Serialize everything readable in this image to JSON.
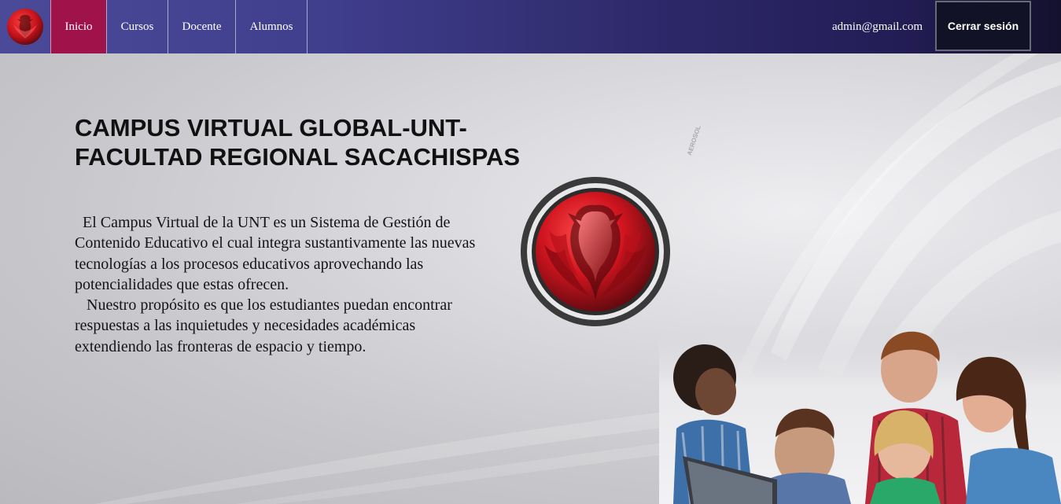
{
  "navbar": {
    "logo_icon": "phoenix-logo-icon",
    "items": [
      {
        "label": "Inicio",
        "active": true
      },
      {
        "label": "Cursos",
        "active": false
      },
      {
        "label": "Docente",
        "active": false
      },
      {
        "label": "Alumnos",
        "active": false
      }
    ],
    "user_email": "admin@gmail.com",
    "logout_label": "Cerrar sesión",
    "colors": {
      "active": "#a0124a",
      "bar_start": "#4a4a98",
      "bar_end": "#14112e"
    }
  },
  "hero": {
    "title": " CAMPUS VIRTUAL GLOBAL-UNT-\nFACULTAD REGIONAL SACACHISPAS",
    "paragraph_1": "  El Campus Virtual de la UNT es un Sistema de Gestión de Contenido Educativo el cual integra sustantivamente las nuevas tecnologías a los procesos educativos aprovechando las potencialidades que estas ofrecen.",
    "paragraph_2": "   Nuestro propósito es que los estudiantes puedan encontrar respuestas a las inquietudes y necesidades académicas extendiendo las fronteras de espacio y tiempo.",
    "watermark_text": "AEROSOL",
    "emblem_icon": "phoenix-emblem-icon",
    "photo_icon": "students-photo"
  }
}
